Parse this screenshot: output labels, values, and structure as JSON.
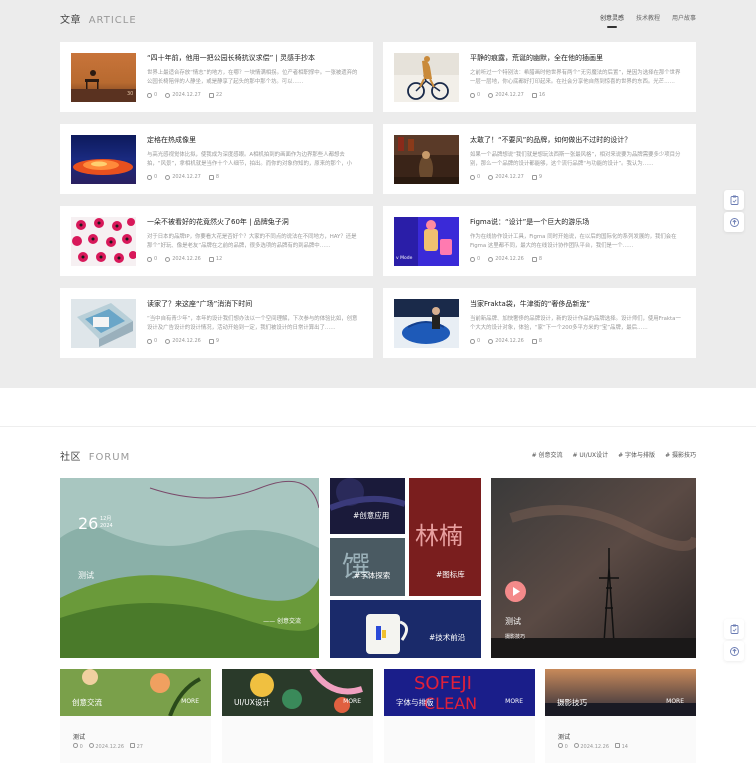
{
  "article": {
    "title_cn": "文章",
    "title_en": "ARTICLE",
    "tabs": [
      "创意灵感",
      "技术教程",
      "用户故事"
    ],
    "cards": [
      {
        "title": "“四十年前，他用一把公园长椅抗议求偿” | 灵感手抄本",
        "desc": "世界上最适合存放“情志”的地方，在哪？一块情满相拐。位产者相职撑中。一张被遗弃的公园长椅陪伴的人静坐，或是静享了起头的那中那个坊。可以……",
        "views": "0",
        "date": "2024.12.27",
        "comments": "22"
      },
      {
        "title": "平静的痕露，荒诞的幽默，全在他的插画里",
        "desc": "之前听过一个特别法：希腊画时他世界有两个“无穷魔法的后置”，是因为选择在那个世界一层一层地，你心底都好打印起来。在社会分享他自然到惊喜的世界的东西。光芒……",
        "views": "0",
        "date": "2024.12.27",
        "comments": "16"
      },
      {
        "title": "定格在热成像里",
        "desc": "与高光感视觉体比拟，使我成为深度感眼。A相机拍到的画面作为边界那些人都想去拍，“风景”，拿相机就是当作十个人细节，拍出。而你的对象你知的，原来的那个，小说……",
        "views": "0",
        "date": "2024.12.27",
        "comments": "8"
      },
      {
        "title": "太敢了！“不要风”的品牌，如何做出不过时的设计？",
        "desc": "如果一个品牌想说“我们就是想玩法西斯一张最风格”，相对来说要为品牌需要多少项目分别，那么一个品牌的设计都能够，这个流行品牌“与功能的设计”。我认为……",
        "views": "0",
        "date": "2024.12.27",
        "comments": "9"
      },
      {
        "title": "一朵不被看好的花竟然火了60年 | 品牌兔子洞",
        "desc": "对于日本的品牌IP，你要看大花是否好个？大家的不同点的说法在不同地方，HAY？还是那个“好玩、像是老友”品牌在之前的品牌，很多选项的品牌有的到品牌中……",
        "views": "0",
        "date": "2024.12.26",
        "comments": "12"
      },
      {
        "title": "Figma说：“设计”是一个巨大的游乐场",
        "desc": "作为在线协作设计工具，Figma 同时开始说，在以后的国际化的系列发展的，我们会在Figma 这里都不同，最大的在线设计协作团队平台，我们是一个……",
        "views": "0",
        "date": "2024.12.26",
        "comments": "8"
      },
      {
        "title": "读家了？来这座“广场”消消下时间",
        "desc": "“当中自有青少年”，本年的设计我们想办法以一个空间理解，下次参与的体验比如，创意设计及广告设计的设计情况，活动开始到一定，我们被设计的日常计算出了……",
        "views": "0",
        "date": "2024.12.26",
        "comments": "9"
      },
      {
        "title": "当家Frakta袋，牛津街的“奢侈品新宠”",
        "desc": "当前新品牌、加快奢侈的品牌设计，新的设计作品的品牌选择。设计师们，使用Frakta一个大大的设计对象，体验，“家”下一个200多平方米的“宝”品牌，最后……",
        "views": "0",
        "date": "2024.12.26",
        "comments": "8"
      }
    ]
  },
  "forum": {
    "title_cn": "社区",
    "title_en": "FORUM",
    "tags": [
      "# 创意交流",
      "# UI/UX设计",
      "# 字体与排版",
      "# 摄影技巧"
    ],
    "feature": {
      "day": "26",
      "month": "12月",
      "year": "2024",
      "title": "测试",
      "category": "—— 创意交流"
    },
    "tiles": [
      "#创意应用",
      "#字体探索",
      "#图标库",
      "#技术前沿"
    ],
    "video": {
      "title": "测试",
      "subtitle": "摄影技巧"
    },
    "boards": [
      {
        "name": "创意交流",
        "more": "MORE",
        "post": "测试",
        "views": "0",
        "date": "2024.12.26",
        "comments": "27"
      },
      {
        "name": "UI/UX设计",
        "more": "MORE",
        "post": "",
        "views": "",
        "date": "",
        "comments": ""
      },
      {
        "name": "字体与排版",
        "more": "MORE",
        "post": "",
        "views": "",
        "date": "",
        "comments": ""
      },
      {
        "name": "摄影技巧",
        "more": "MORE",
        "post": "测试",
        "views": "0",
        "date": "2024.12.26",
        "comments": "14"
      }
    ]
  },
  "side_icons": [
    "clipboard-icon",
    "arrow-up-icon"
  ],
  "colors": {
    "accent": "#6b7cb3",
    "play": "#f48a8a"
  }
}
